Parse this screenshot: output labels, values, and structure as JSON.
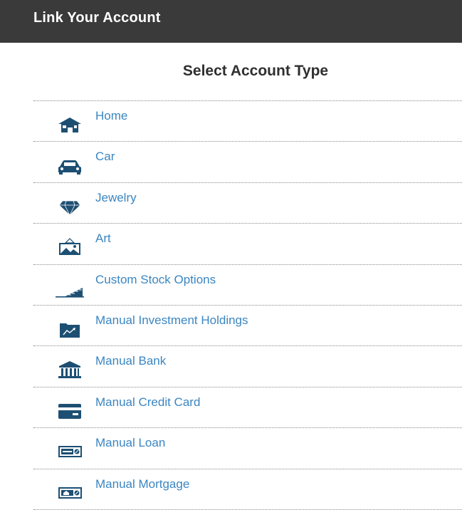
{
  "header": {
    "title": "Link Your Account"
  },
  "main": {
    "section_title": "Select Account Type",
    "items": [
      {
        "label": "Home",
        "icon": "house-icon"
      },
      {
        "label": "Car",
        "icon": "car-icon"
      },
      {
        "label": "Jewelry",
        "icon": "diamond-icon"
      },
      {
        "label": "Art",
        "icon": "landscape-picture-icon"
      },
      {
        "label": "Custom Stock Options",
        "icon": "rising-stairs-chart-icon"
      },
      {
        "label": "Manual Investment Holdings",
        "icon": "folder-trend-icon"
      },
      {
        "label": "Manual Bank",
        "icon": "bank-building-icon"
      },
      {
        "label": "Manual Credit Card",
        "icon": "credit-card-icon"
      },
      {
        "label": "Manual Loan",
        "icon": "loan-check-icon"
      },
      {
        "label": "Manual Mortgage",
        "icon": "mortgage-check-icon"
      }
    ]
  },
  "colors": {
    "header_bg": "#3a3a3a",
    "header_text": "#ffffff",
    "link": "#3b86c1",
    "icon": "#1d4f73",
    "title": "#2f2f2f"
  }
}
